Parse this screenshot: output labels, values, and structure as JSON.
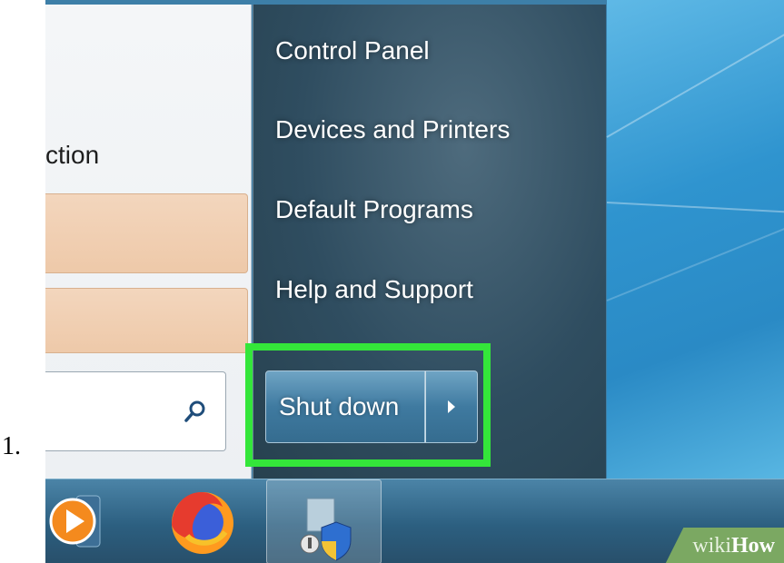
{
  "step": {
    "number": "1."
  },
  "left_pane": {
    "partial_label": "ction"
  },
  "right_pane": {
    "items": [
      {
        "label": "Control Panel"
      },
      {
        "label": "Devices and Printers"
      },
      {
        "label": "Default Programs"
      },
      {
        "label": "Help and Support"
      }
    ]
  },
  "power": {
    "shutdown_label": "Shut down"
  },
  "highlight_color": "#34e63a",
  "taskbar": {
    "apps": [
      {
        "icon": "media-player-icon"
      },
      {
        "icon": "firefox-icon"
      },
      {
        "icon": "control-panel-shield-icon"
      }
    ]
  },
  "watermark": {
    "prefix": "wiki",
    "suffix": "How"
  }
}
